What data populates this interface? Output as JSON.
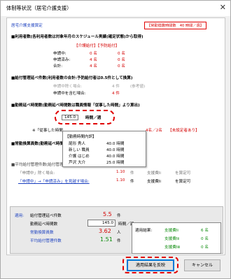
{
  "window": {
    "title": "体制等状況（居宅介護支援）",
    "close_glyph": "✕"
  },
  "section_title": "居宅介護支援算定",
  "avg_time_box": "【常勤換算時間数　40 時間／週】",
  "care_managers": {
    "heading": "■利用者数(各利用者数は対象年月のスケジュール実績(確定状態)から取得)",
    "col_header": "【介護給付】【予防給付】",
    "rows": [
      {
        "label": "申請中:",
        "care": "0 名",
        "prev": "0 名"
      },
      {
        "label": "申請済み:",
        "care": "4 名",
        "prev": "0 名"
      },
      {
        "label": "合計:",
        "care": "4 名",
        "prev": "0 名"
      }
    ]
  },
  "benefit_count": {
    "heading": "■給付管理延べ件数(利用者数の合計:予防給付者は0.5件として換算)",
    "rows": [
      {
        "label": "申請中除く場合:",
        "value": "4 件",
        "note": "(参考値)"
      },
      {
        "label": "申請中を含む場合:",
        "value": "4 件",
        "note": ""
      }
    ]
  },
  "work_hours": {
    "heading": "■勤務延べ時間数(勤務延べ時間数は職員情報「従事した時間」より算出)",
    "value": "145.0",
    "unit": "時間／週",
    "note_prefix": "※「従事した時間",
    "note_tail": "4名／2名",
    "note_tail_red": "【未設定者あり】"
  },
  "popup": {
    "title": "【勤務時間内訳】",
    "rows": [
      {
        "name": "尾形 秀人",
        "hours": "40.0 時間"
      },
      {
        "name": "新しい 職員",
        "hours": "40.0 時間"
      },
      {
        "name": "介護 はじめ",
        "hours": "40.0 時間"
      },
      {
        "name": "芦沢 大介",
        "hours": "25.0 時間"
      }
    ]
  },
  "fte_heading": "■常勤換算員数(勤務延べ時間数÷",
  "avg_benefit": {
    "heading": "■平均給付管理件数(給付管理延べ件数 ÷ 常勤換算員数)と判定結果",
    "rows": [
      {
        "label": "「申請中」除く場合:",
        "value": "1.10",
        "unit": "件",
        "result": "支援費Ⅰⅰ",
        "status": "を算定可"
      },
      {
        "label": "「申請中」→「申請済み」を見越す場合:",
        "value": "1.10",
        "unit": "件",
        "result": "支援費Ⅰⅰ",
        "status": "を算定可"
      }
    ]
  },
  "applied": {
    "label": "適用:",
    "fields": [
      {
        "label": "給付管理延べ件数",
        "value": "5.5",
        "unit": "件"
      },
      {
        "label": "勤務延べ時間数",
        "value": "145.0",
        "unit": "時間／週"
      },
      {
        "label": "常勤換算員数",
        "value": "3.62",
        "unit": "人"
      },
      {
        "label": "平均給付管理件数",
        "value": "1.51",
        "unit": "件"
      }
    ]
  },
  "result": {
    "label": "適用結果:",
    "rows": [
      {
        "name": "支援費Ⅰⅰ",
        "value": "6 名"
      },
      {
        "name": "支援費Ⅰⅱ",
        "value": "0 名"
      },
      {
        "name": "支援費Ⅰⅲ",
        "value": "0 名"
      }
    ]
  },
  "buttons": {
    "apply": "適用結果を反映",
    "cancel": "キャンセル"
  },
  "colors": {
    "accent_blue": "#1a3fbf",
    "alert_red": "#d40000",
    "green": "#0a8a0a"
  }
}
